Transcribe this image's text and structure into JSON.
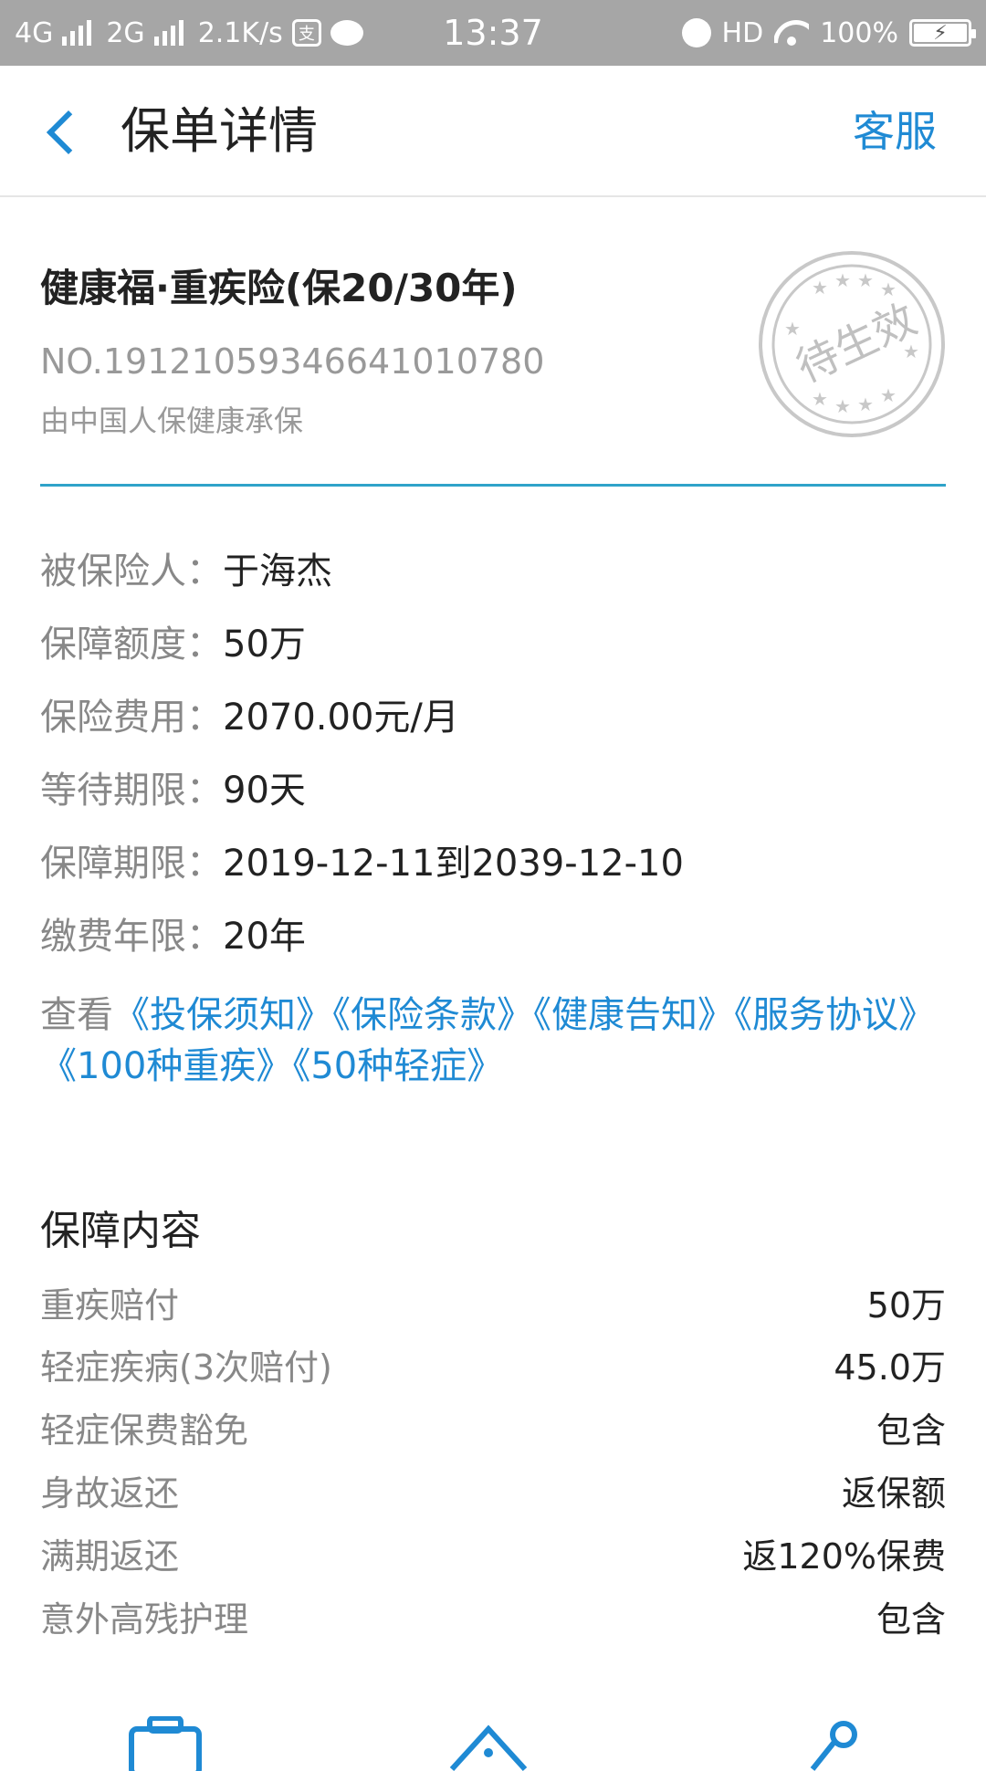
{
  "status_bar": {
    "network1": "4G",
    "network2": "2G",
    "speed": "2.1K/s",
    "pay_icon_text": "支",
    "time": "13:37",
    "hd": "HD",
    "battery": "100%",
    "icons": [
      "signal-icon",
      "alipay-icon",
      "chat-bubble-icon",
      "alarm-icon",
      "wifi-icon",
      "battery-icon"
    ]
  },
  "header": {
    "title": "保单详情",
    "service_label": "客服",
    "accent_color": "#1f8ad4"
  },
  "policy": {
    "name": "健康福·重疾险(保20/30年)",
    "number": "NO.19121059346641010780",
    "insurer": "由中国人保健康承保",
    "stamp_text": "待生效"
  },
  "info": [
    {
      "label": "被保险人：",
      "value": "于海杰"
    },
    {
      "label": "保障额度：",
      "value": "50万"
    },
    {
      "label": "保险费用：",
      "value": "2070.00元/月"
    },
    {
      "label": "等待期限：",
      "value": "90天"
    },
    {
      "label": "保障期限：",
      "value": "2019-12-11到2039-12-10"
    },
    {
      "label": "缴费年限：",
      "value": "20年"
    }
  ],
  "documents": {
    "prefix": "查看",
    "links": [
      "《投保须知》",
      "《保险条款》",
      "《健康告知》",
      "《服务协议》",
      "《100种重疾》",
      "《50种轻症》"
    ]
  },
  "coverage": {
    "title": "保障内容",
    "items": [
      {
        "name": "重疾赔付",
        "value": "50万"
      },
      {
        "name": "轻症疾病(3次赔付)",
        "value": "45.0万"
      },
      {
        "name": "轻症保费豁免",
        "value": "包含"
      },
      {
        "name": "身故返还",
        "value": "返保额"
      },
      {
        "name": "满期返还",
        "value": "返120%保费"
      },
      {
        "name": "意外高残护理",
        "value": "包含"
      }
    ]
  },
  "bottom_icons": [
    "briefcase-icon",
    "home-icon",
    "share-icon"
  ]
}
